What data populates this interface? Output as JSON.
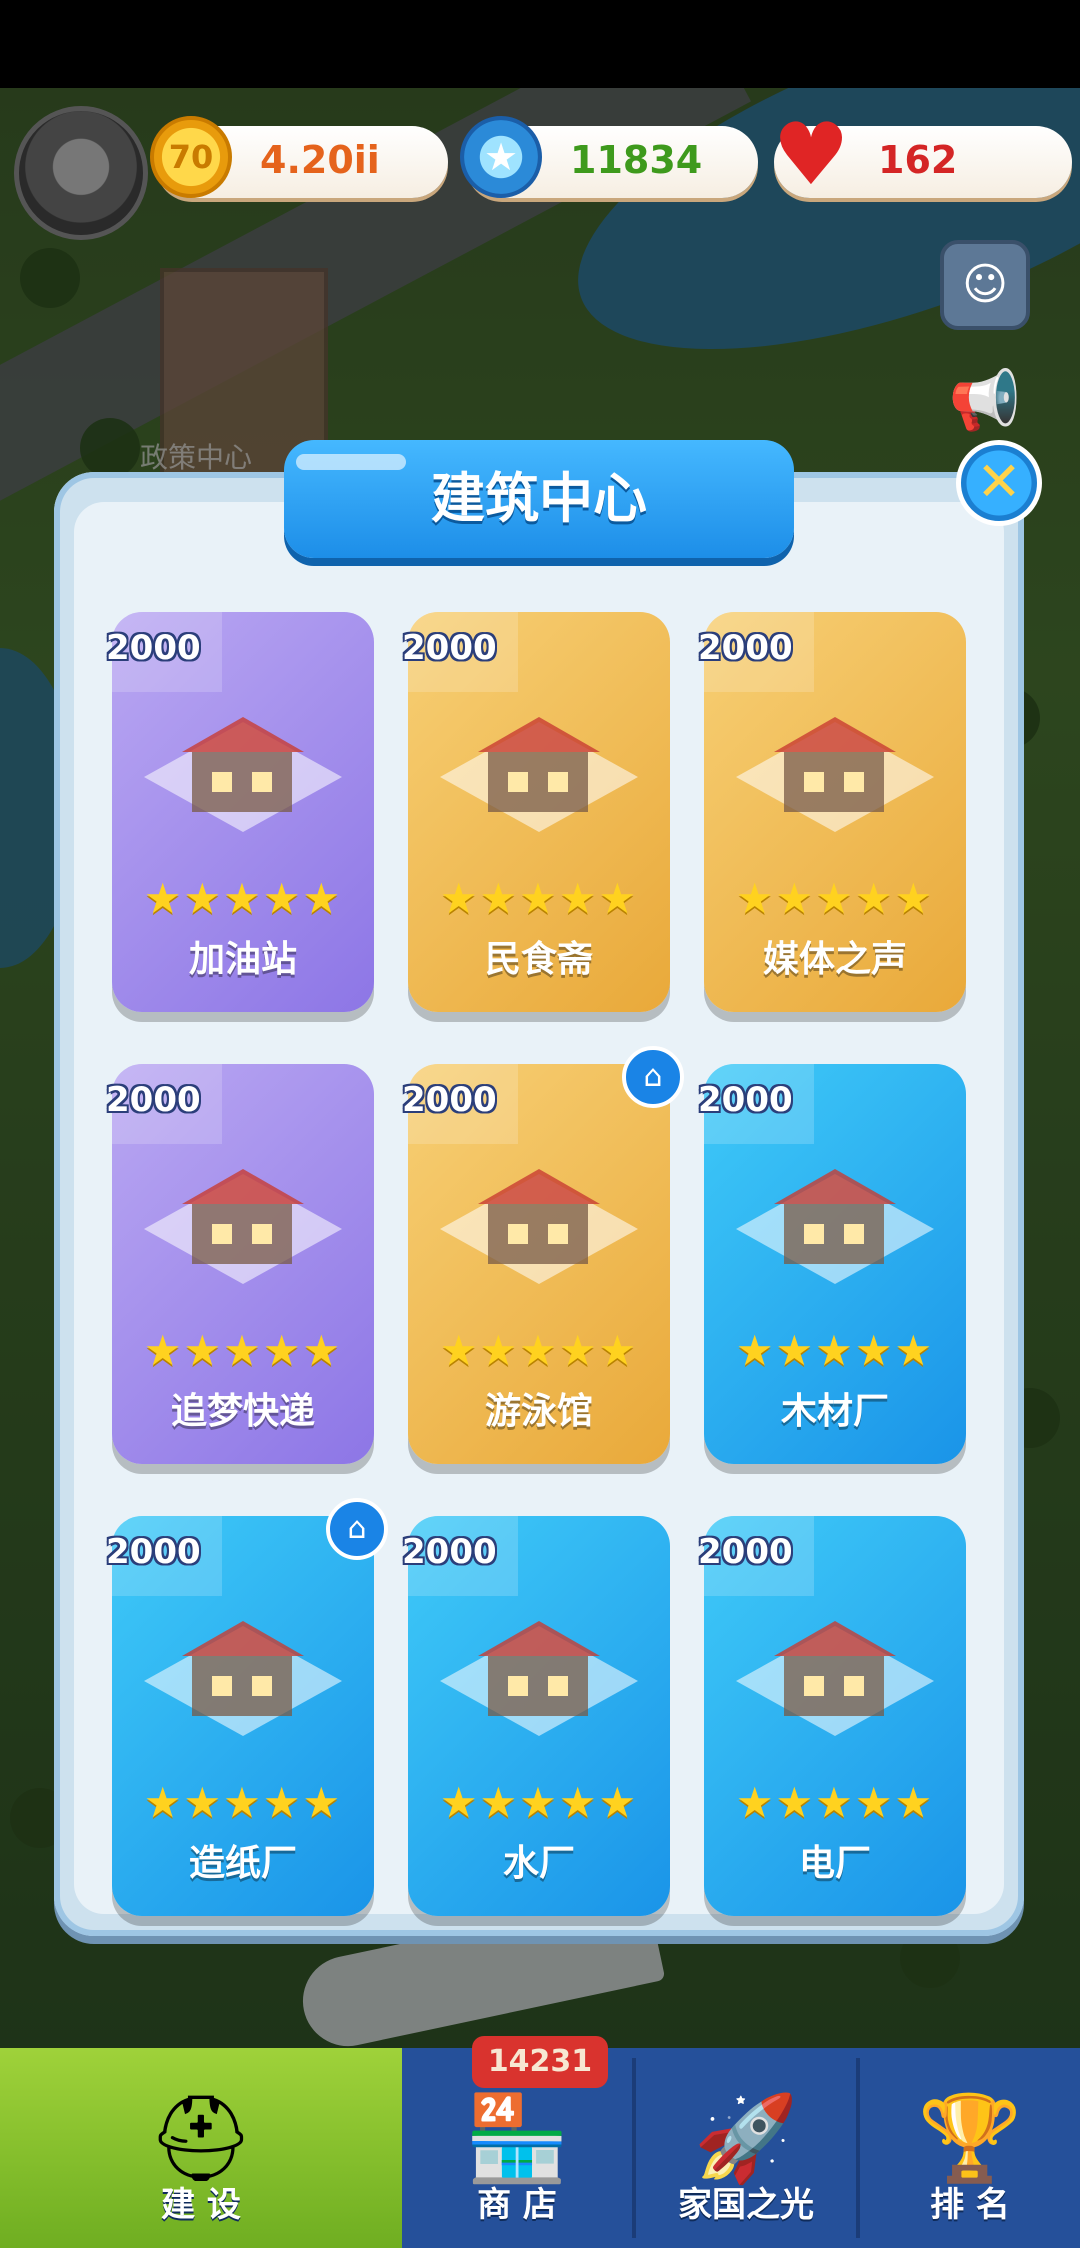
{
  "hud": {
    "coins": "4.20ii",
    "gems": "11834",
    "hearts": "162",
    "coin_icon_text": "70"
  },
  "background": {
    "label": "政策中心"
  },
  "modal": {
    "title": "建筑中心",
    "close_label": "✕",
    "cards": [
      {
        "price": "2000",
        "name": "加油站",
        "stars": "★★★★★",
        "theme": "purple",
        "home": false
      },
      {
        "price": "2000",
        "name": "民食斋",
        "stars": "★★★★★",
        "theme": "orange",
        "home": false
      },
      {
        "price": "2000",
        "name": "媒体之声",
        "stars": "★★★★★",
        "theme": "orange",
        "home": false
      },
      {
        "price": "2000",
        "name": "追梦快递",
        "stars": "★★★★★",
        "theme": "purple",
        "home": false
      },
      {
        "price": "2000",
        "name": "游泳馆",
        "stars": "★★★★★",
        "theme": "orange",
        "home": true
      },
      {
        "price": "2000",
        "name": "木材厂",
        "stars": "★★★★★",
        "theme": "blue",
        "home": false
      },
      {
        "price": "2000",
        "name": "造纸厂",
        "stars": "★★★★★",
        "theme": "blue",
        "home": true
      },
      {
        "price": "2000",
        "name": "水厂",
        "stars": "★★★★★",
        "theme": "blue",
        "home": false
      },
      {
        "price": "2000",
        "name": "电厂",
        "stars": "★★★★★",
        "theme": "blue",
        "home": false
      }
    ]
  },
  "nav": {
    "build": "建 设",
    "shop": "商 店",
    "shop_badge": "14231",
    "home_light": "家国之光",
    "rank": "排 名"
  },
  "colors": {
    "purple": "#8d76e6",
    "orange": "#e9a93a",
    "blue": "#1a94e8",
    "nav_bg": "#25509a",
    "nav_active": "#6fae21"
  },
  "icons": {
    "build": "hardhat-icon",
    "shop": "shop-icon",
    "home_light": "rocket-icon",
    "rank": "ranking-icon",
    "card_home": "home-icon"
  }
}
